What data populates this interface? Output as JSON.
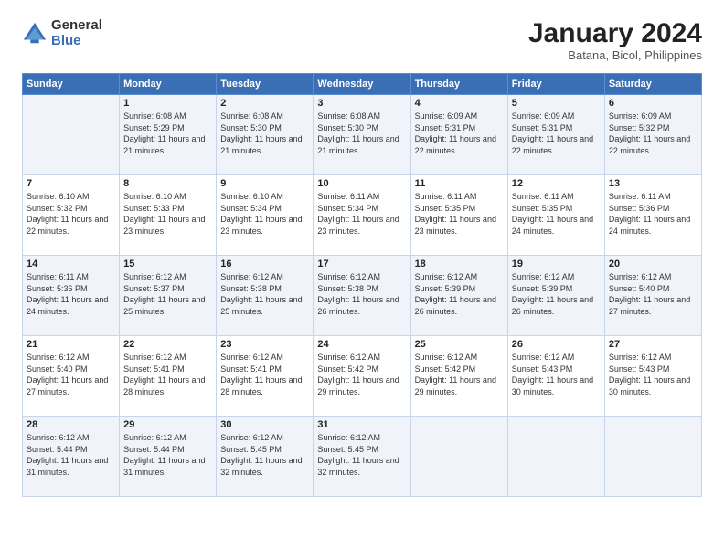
{
  "header": {
    "logo_general": "General",
    "logo_blue": "Blue",
    "month_title": "January 2024",
    "location": "Batana, Bicol, Philippines"
  },
  "days_of_week": [
    "Sunday",
    "Monday",
    "Tuesday",
    "Wednesday",
    "Thursday",
    "Friday",
    "Saturday"
  ],
  "weeks": [
    [
      {
        "day": "",
        "sunrise": "",
        "sunset": "",
        "daylight": ""
      },
      {
        "day": "1",
        "sunrise": "Sunrise: 6:08 AM",
        "sunset": "Sunset: 5:29 PM",
        "daylight": "Daylight: 11 hours and 21 minutes."
      },
      {
        "day": "2",
        "sunrise": "Sunrise: 6:08 AM",
        "sunset": "Sunset: 5:30 PM",
        "daylight": "Daylight: 11 hours and 21 minutes."
      },
      {
        "day": "3",
        "sunrise": "Sunrise: 6:08 AM",
        "sunset": "Sunset: 5:30 PM",
        "daylight": "Daylight: 11 hours and 21 minutes."
      },
      {
        "day": "4",
        "sunrise": "Sunrise: 6:09 AM",
        "sunset": "Sunset: 5:31 PM",
        "daylight": "Daylight: 11 hours and 22 minutes."
      },
      {
        "day": "5",
        "sunrise": "Sunrise: 6:09 AM",
        "sunset": "Sunset: 5:31 PM",
        "daylight": "Daylight: 11 hours and 22 minutes."
      },
      {
        "day": "6",
        "sunrise": "Sunrise: 6:09 AM",
        "sunset": "Sunset: 5:32 PM",
        "daylight": "Daylight: 11 hours and 22 minutes."
      }
    ],
    [
      {
        "day": "7",
        "sunrise": "Sunrise: 6:10 AM",
        "sunset": "Sunset: 5:32 PM",
        "daylight": "Daylight: 11 hours and 22 minutes."
      },
      {
        "day": "8",
        "sunrise": "Sunrise: 6:10 AM",
        "sunset": "Sunset: 5:33 PM",
        "daylight": "Daylight: 11 hours and 23 minutes."
      },
      {
        "day": "9",
        "sunrise": "Sunrise: 6:10 AM",
        "sunset": "Sunset: 5:34 PM",
        "daylight": "Daylight: 11 hours and 23 minutes."
      },
      {
        "day": "10",
        "sunrise": "Sunrise: 6:11 AM",
        "sunset": "Sunset: 5:34 PM",
        "daylight": "Daylight: 11 hours and 23 minutes."
      },
      {
        "day": "11",
        "sunrise": "Sunrise: 6:11 AM",
        "sunset": "Sunset: 5:35 PM",
        "daylight": "Daylight: 11 hours and 23 minutes."
      },
      {
        "day": "12",
        "sunrise": "Sunrise: 6:11 AM",
        "sunset": "Sunset: 5:35 PM",
        "daylight": "Daylight: 11 hours and 24 minutes."
      },
      {
        "day": "13",
        "sunrise": "Sunrise: 6:11 AM",
        "sunset": "Sunset: 5:36 PM",
        "daylight": "Daylight: 11 hours and 24 minutes."
      }
    ],
    [
      {
        "day": "14",
        "sunrise": "Sunrise: 6:11 AM",
        "sunset": "Sunset: 5:36 PM",
        "daylight": "Daylight: 11 hours and 24 minutes."
      },
      {
        "day": "15",
        "sunrise": "Sunrise: 6:12 AM",
        "sunset": "Sunset: 5:37 PM",
        "daylight": "Daylight: 11 hours and 25 minutes."
      },
      {
        "day": "16",
        "sunrise": "Sunrise: 6:12 AM",
        "sunset": "Sunset: 5:38 PM",
        "daylight": "Daylight: 11 hours and 25 minutes."
      },
      {
        "day": "17",
        "sunrise": "Sunrise: 6:12 AM",
        "sunset": "Sunset: 5:38 PM",
        "daylight": "Daylight: 11 hours and 26 minutes."
      },
      {
        "day": "18",
        "sunrise": "Sunrise: 6:12 AM",
        "sunset": "Sunset: 5:39 PM",
        "daylight": "Daylight: 11 hours and 26 minutes."
      },
      {
        "day": "19",
        "sunrise": "Sunrise: 6:12 AM",
        "sunset": "Sunset: 5:39 PM",
        "daylight": "Daylight: 11 hours and 26 minutes."
      },
      {
        "day": "20",
        "sunrise": "Sunrise: 6:12 AM",
        "sunset": "Sunset: 5:40 PM",
        "daylight": "Daylight: 11 hours and 27 minutes."
      }
    ],
    [
      {
        "day": "21",
        "sunrise": "Sunrise: 6:12 AM",
        "sunset": "Sunset: 5:40 PM",
        "daylight": "Daylight: 11 hours and 27 minutes."
      },
      {
        "day": "22",
        "sunrise": "Sunrise: 6:12 AM",
        "sunset": "Sunset: 5:41 PM",
        "daylight": "Daylight: 11 hours and 28 minutes."
      },
      {
        "day": "23",
        "sunrise": "Sunrise: 6:12 AM",
        "sunset": "Sunset: 5:41 PM",
        "daylight": "Daylight: 11 hours and 28 minutes."
      },
      {
        "day": "24",
        "sunrise": "Sunrise: 6:12 AM",
        "sunset": "Sunset: 5:42 PM",
        "daylight": "Daylight: 11 hours and 29 minutes."
      },
      {
        "day": "25",
        "sunrise": "Sunrise: 6:12 AM",
        "sunset": "Sunset: 5:42 PM",
        "daylight": "Daylight: 11 hours and 29 minutes."
      },
      {
        "day": "26",
        "sunrise": "Sunrise: 6:12 AM",
        "sunset": "Sunset: 5:43 PM",
        "daylight": "Daylight: 11 hours and 30 minutes."
      },
      {
        "day": "27",
        "sunrise": "Sunrise: 6:12 AM",
        "sunset": "Sunset: 5:43 PM",
        "daylight": "Daylight: 11 hours and 30 minutes."
      }
    ],
    [
      {
        "day": "28",
        "sunrise": "Sunrise: 6:12 AM",
        "sunset": "Sunset: 5:44 PM",
        "daylight": "Daylight: 11 hours and 31 minutes."
      },
      {
        "day": "29",
        "sunrise": "Sunrise: 6:12 AM",
        "sunset": "Sunset: 5:44 PM",
        "daylight": "Daylight: 11 hours and 31 minutes."
      },
      {
        "day": "30",
        "sunrise": "Sunrise: 6:12 AM",
        "sunset": "Sunset: 5:45 PM",
        "daylight": "Daylight: 11 hours and 32 minutes."
      },
      {
        "day": "31",
        "sunrise": "Sunrise: 6:12 AM",
        "sunset": "Sunset: 5:45 PM",
        "daylight": "Daylight: 11 hours and 32 minutes."
      },
      {
        "day": "",
        "sunrise": "",
        "sunset": "",
        "daylight": ""
      },
      {
        "day": "",
        "sunrise": "",
        "sunset": "",
        "daylight": ""
      },
      {
        "day": "",
        "sunrise": "",
        "sunset": "",
        "daylight": ""
      }
    ]
  ]
}
